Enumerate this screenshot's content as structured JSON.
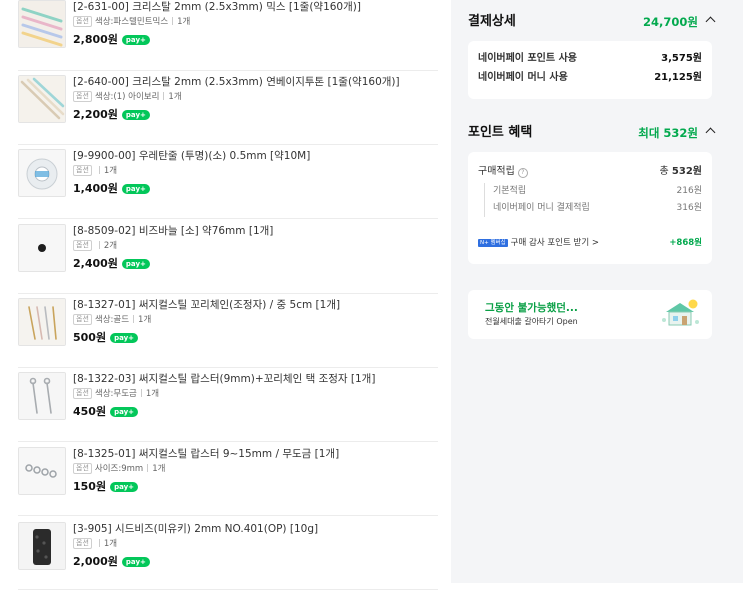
{
  "items": [
    {
      "title": "[2-631-00] 크리스탈 2mm (2.5x3mm) 믹스 [1줄(약160개)]",
      "tag": "옵션",
      "option": "색상:파스텔민트믹스",
      "qty": "1개",
      "price": "2,800원",
      "pay_badge": "pay+"
    },
    {
      "title": "[2-640-00] 크리스탈 2mm (2.5x3mm) 연베이지투톤 [1줄(약160개)]",
      "tag": "옵션",
      "option": "색상:(1) 아이보리",
      "qty": "1개",
      "price": "2,200원",
      "pay_badge": "pay+"
    },
    {
      "title": "[9-9900-00] 우레탄줄 (투명)(소) 0.5mm [약10M]",
      "tag": "옵션",
      "option": "",
      "qty": "1개",
      "price": "1,400원",
      "pay_badge": "pay+"
    },
    {
      "title": "[8-8509-02] 비즈바늘 [소] 약76mm [1개]",
      "tag": "옵션",
      "option": "",
      "qty": "2개",
      "price": "2,400원",
      "pay_badge": "pay+"
    },
    {
      "title": "[8-1327-01] 써지컬스틸 꼬리체인(조정자) / 중 5cm [1개]",
      "tag": "옵션",
      "option": "색상:골드",
      "qty": "1개",
      "price": "500원",
      "pay_badge": "pay+"
    },
    {
      "title": "[8-1322-03] 써지컬스틸 랍스터(9mm)+꼬리체인 택 조정자 [1개]",
      "tag": "옵션",
      "option": "색상:무도금",
      "qty": "1개",
      "price": "450원",
      "pay_badge": "pay+"
    },
    {
      "title": "[8-1325-01] 써지컬스틸 랍스터 9~15mm / 무도금 [1개]",
      "tag": "옵션",
      "option": "사이즈:9mm",
      "qty": "1개",
      "price": "150원",
      "pay_badge": "pay+"
    },
    {
      "title": "[3-905] 시드비즈(미유키) 2mm NO.401(OP) [10g]",
      "tag": "옵션",
      "option": "",
      "qty": "1개",
      "price": "2,000원",
      "pay_badge": "pay+"
    }
  ],
  "payment": {
    "title": "결제상세",
    "total": "24,700원",
    "rows": [
      {
        "label": "네이버페이 포인트 사용",
        "value": "3,575원"
      },
      {
        "label": "네이버페이 머니 사용",
        "value": "21,125원"
      }
    ]
  },
  "points": {
    "title": "포인트 혜택",
    "max": "최대 532원",
    "main_label": "구매적립",
    "help_icon": "?",
    "main_prefix": "총",
    "main_value": "532원",
    "subs": [
      {
        "label": "기본적립",
        "value": "216원"
      },
      {
        "label": "네이버페이 머니 결제적립",
        "value": "316원"
      }
    ],
    "bonus_badge": "N+ 멤버십",
    "bonus_label": "구매 감사 포인트 받기 >",
    "bonus_value": "+868원"
  },
  "banner": {
    "title": "그동안 불가능했던...",
    "subtitle": "전월세대출 갈아타기 Open"
  },
  "colors": {
    "accent_green": "#03c75a",
    "side_bg": "#f4f5f7"
  }
}
